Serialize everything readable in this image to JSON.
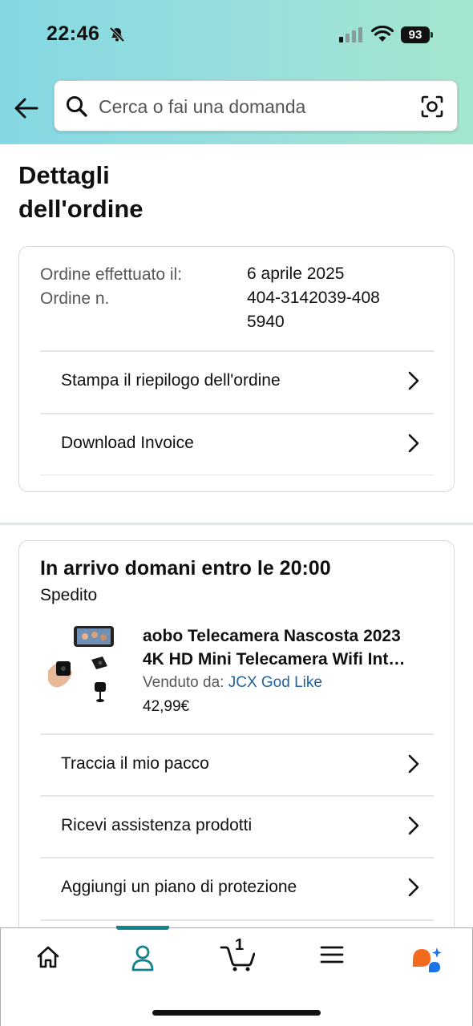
{
  "status_bar": {
    "time": "22:46",
    "battery": "93"
  },
  "search": {
    "placeholder": "Cerca o fai una domanda"
  },
  "page": {
    "title": "Dettagli dell'ordine"
  },
  "order_info": {
    "date_label": "Ordine effettuato il:",
    "date_value": "6 aprile 2025",
    "number_label": "Ordine n.",
    "number_value": "404-3142039-4085940",
    "actions": [
      {
        "label": "Stampa il riepilogo dell'ordine"
      },
      {
        "label": "Download Invoice"
      }
    ]
  },
  "shipment": {
    "title": "In arrivo domani entro le 20:00",
    "status": "Spedito",
    "product": {
      "title_line1": "aobo Telecamera Nascosta 2023",
      "title_line2": "4K HD Mini Telecamera Wifi Int…",
      "seller_label": "Venduto da:",
      "seller_name": "JCX God Like",
      "price": "42,99€"
    },
    "actions": [
      {
        "label": "Traccia il mio pacco"
      },
      {
        "label": "Ricevi assistenza prodotti"
      },
      {
        "label": "Aggiungi un piano di protezione"
      }
    ]
  },
  "tabbar": {
    "cart_count": "1",
    "tabs": [
      "home-icon",
      "account-icon",
      "cart-icon",
      "menu-icon",
      "rufus-ai-icon"
    ],
    "active_color": "#14828c"
  }
}
